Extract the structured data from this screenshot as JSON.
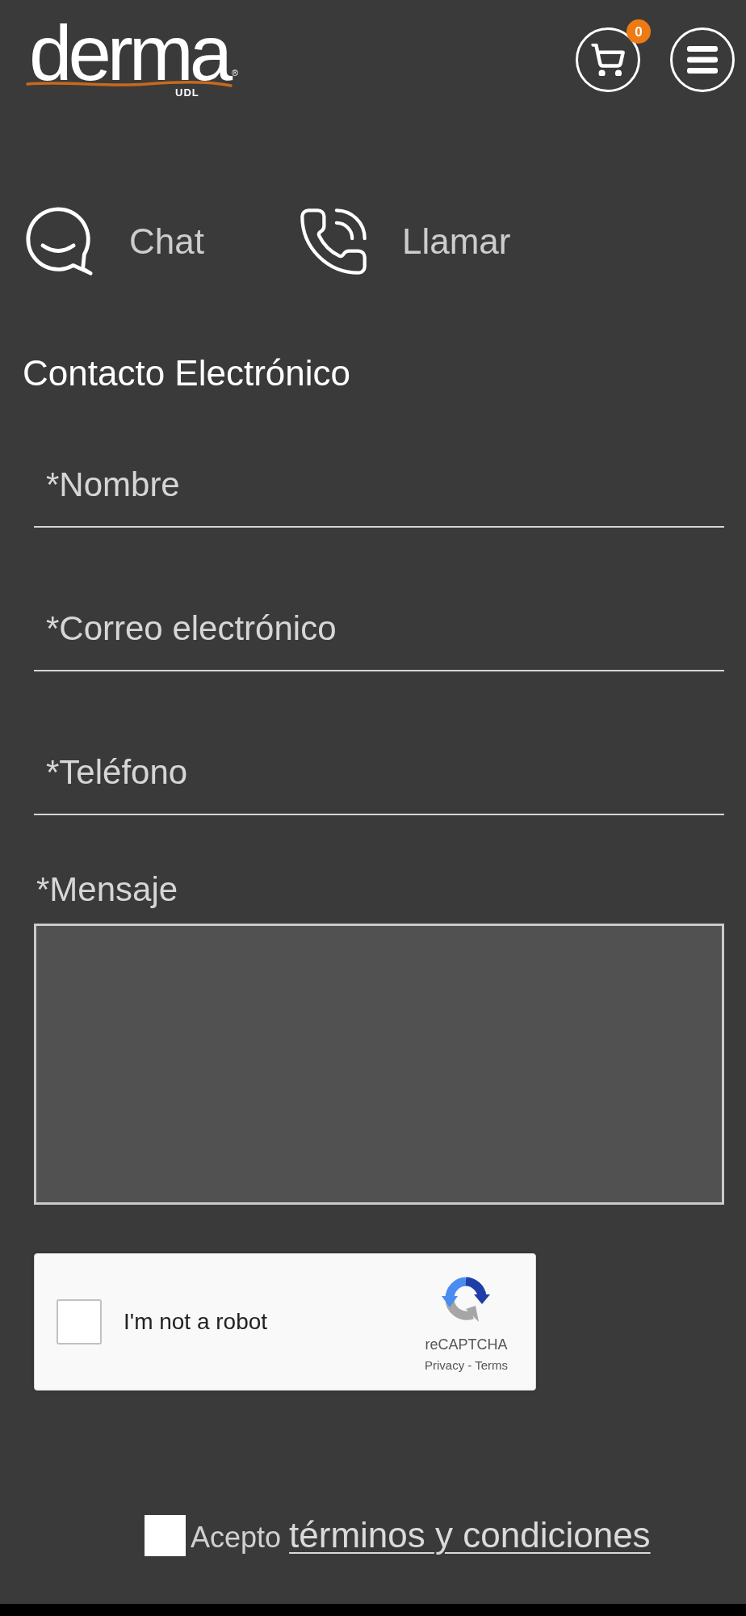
{
  "header": {
    "logo": {
      "wordmark": "derma",
      "mark": "®",
      "subtitle": "UDL"
    },
    "cart": {
      "count": "0"
    }
  },
  "contact_options": [
    {
      "kind": "chat",
      "label": "Chat"
    },
    {
      "kind": "call",
      "label": "Llamar"
    }
  ],
  "form": {
    "title": "Contacto Electrónico",
    "fields": [
      {
        "placeholder": "*Nombre"
      },
      {
        "placeholder": "*Correo electrónico"
      },
      {
        "placeholder": "*Teléfono"
      }
    ],
    "message": {
      "label": "*Mensaje"
    },
    "captcha": {
      "label": "I'm not a robot",
      "checked": false,
      "brand": "reCAPTCHA",
      "links": [
        "Privacy",
        "Terms"
      ],
      "separator": "-"
    },
    "terms": {
      "checked": false,
      "label": "Acepto",
      "link": "términos y condiciones"
    }
  }
}
